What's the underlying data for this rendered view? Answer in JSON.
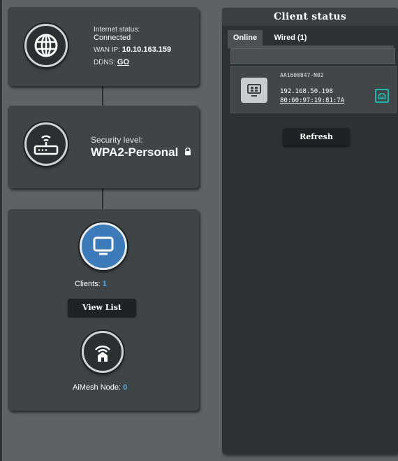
{
  "internet": {
    "status_label": "Internet status:",
    "status_value": "Connected",
    "wan_label": "WAN IP:",
    "wan_value": "10.10.163.159",
    "ddns_label": "DDNS:",
    "ddns_value": "GO"
  },
  "security": {
    "label": "Security level:",
    "value": "WPA2-Personal"
  },
  "clients": {
    "label": "Clients:",
    "count": "1",
    "view_list": "View List"
  },
  "aimesh": {
    "label": "AiMesh Node:",
    "count": "0"
  },
  "client_status": {
    "title": "Client status",
    "tabs": [
      "Online",
      "Wired (1)"
    ],
    "filter_placeholder": "",
    "entries": [
      {
        "name": "AA1600847-N02",
        "ip": "192.168.50.198",
        "mac": "80:60:97:19:81:7A"
      }
    ],
    "refresh": "Refresh"
  },
  "colors": {
    "accent": "#58a8dc",
    "card": "#3f4446",
    "panel": "#2c3133",
    "background": "#5d6264"
  }
}
